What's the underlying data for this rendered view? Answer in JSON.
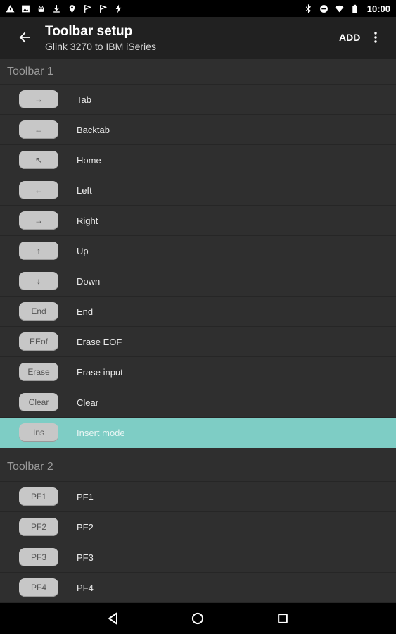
{
  "status_bar": {
    "time": "10:00",
    "left_icons": [
      "warning-icon",
      "image-icon",
      "android-icon",
      "download-icon",
      "location-icon",
      "flag-icon",
      "flag-icon",
      "flash-icon"
    ],
    "right_icons": [
      "bluetooth-icon",
      "do-not-disturb-icon",
      "wifi-icon",
      "battery-icon"
    ]
  },
  "app_bar": {
    "title": "Toolbar setup",
    "subtitle": "Glink 3270 to IBM iSeries",
    "add_label": "ADD",
    "accent_color": "#7ecdc5"
  },
  "toolbars": [
    {
      "header": "Toolbar 1",
      "items": [
        {
          "key": "→",
          "label": "Tab"
        },
        {
          "key": "←",
          "label": "Backtab"
        },
        {
          "key": "↖",
          "label": "Home"
        },
        {
          "key": "←",
          "label": "Left"
        },
        {
          "key": "→",
          "label": "Right"
        },
        {
          "key": "↑",
          "label": "Up"
        },
        {
          "key": "↓",
          "label": "Down"
        },
        {
          "key": "End",
          "label": "End"
        },
        {
          "key": "EEof",
          "label": "Erase EOF"
        },
        {
          "key": "Erase",
          "label": "Erase input"
        },
        {
          "key": "Clear",
          "label": "Clear"
        },
        {
          "key": "Ins",
          "label": "Insert mode",
          "selected": true
        }
      ]
    },
    {
      "header": "Toolbar 2",
      "items": [
        {
          "key": "PF1",
          "label": "PF1"
        },
        {
          "key": "PF2",
          "label": "PF2"
        },
        {
          "key": "PF3",
          "label": "PF3"
        },
        {
          "key": "PF4",
          "label": "PF4"
        }
      ]
    }
  ]
}
